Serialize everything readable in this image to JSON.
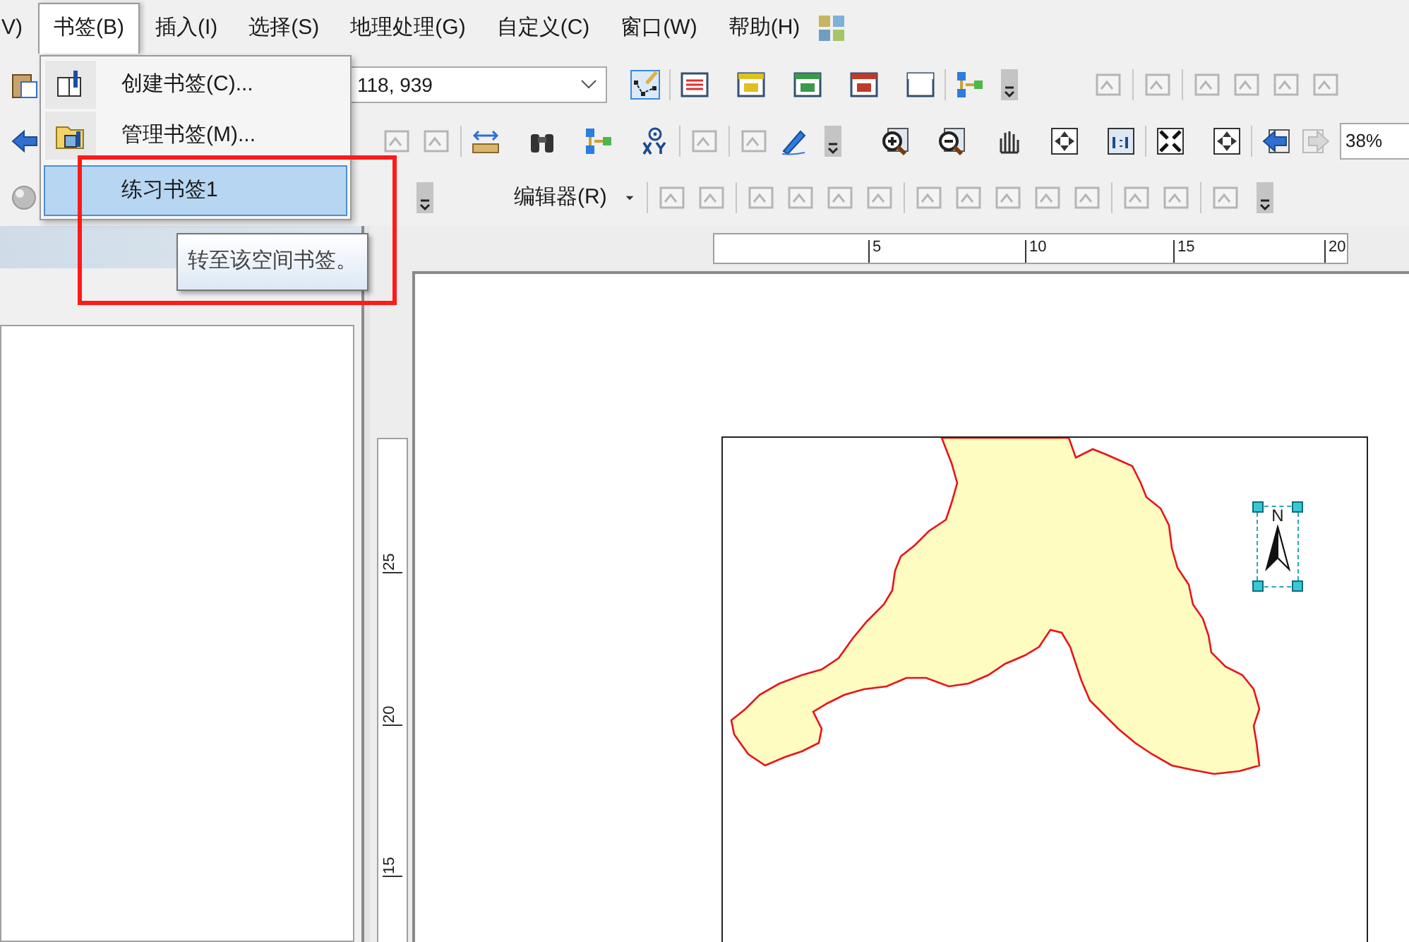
{
  "menu_bar": {
    "items": [
      {
        "label": "V)",
        "selected": false
      },
      {
        "label": "书签(B)",
        "selected": true
      },
      {
        "label": "插入(I)",
        "selected": false
      },
      {
        "label": "选择(S)",
        "selected": false
      },
      {
        "label": "地理处理(G)",
        "selected": false
      },
      {
        "label": "自定义(C)",
        "selected": false
      },
      {
        "label": "窗口(W)",
        "selected": false
      },
      {
        "label": "帮助(H)",
        "selected": false
      }
    ]
  },
  "bookmark_menu": {
    "items": [
      {
        "label": "创建书签(C)...",
        "kind": "create",
        "selected": false
      },
      {
        "label": "管理书签(M)...",
        "kind": "manage",
        "selected": false
      },
      {
        "label": "练习书签1",
        "kind": "bookmark",
        "selected": true
      }
    ]
  },
  "tooltip": {
    "text": "转至该空间书签。"
  },
  "toolbar": {
    "coordinates": "118, 939",
    "zoom": "38%",
    "editor_menu": "编辑器(R)"
  },
  "layout_view": {
    "top_ruler": [
      "5",
      "10",
      "15",
      "20"
    ],
    "left_ruler": [
      "25",
      "20",
      "15"
    ],
    "north_arrow": {
      "label": "N",
      "selected": true
    }
  }
}
